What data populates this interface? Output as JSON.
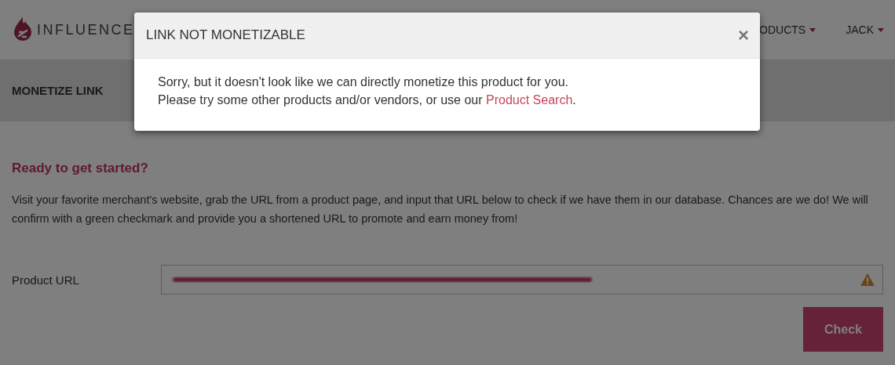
{
  "header": {
    "logo_text": "INFLUENCE",
    "nav": [
      {
        "label": "ODUCTS"
      },
      {
        "label": "JACK"
      }
    ]
  },
  "section_title": "MONETIZE LINK",
  "intro": {
    "heading": "Ready to get started?",
    "text": "Visit your favorite merchant's website, grab the URL from a product page, and input that URL below to check if we have them in our database. Chances are we do! We will confirm with a green checkmark and provide you a shortened URL to promote and earn money from!"
  },
  "form": {
    "label": "Product URL",
    "warning": true,
    "button": "Check"
  },
  "modal": {
    "title": "LINK NOT MONETIZABLE",
    "close": "×",
    "lines": [
      "Sorry, but it doesn't look like we can directly monetize this product for you.",
      "Please try some other products and/or vendors, or use our "
    ],
    "link": "Product Search",
    "after_link": "."
  }
}
